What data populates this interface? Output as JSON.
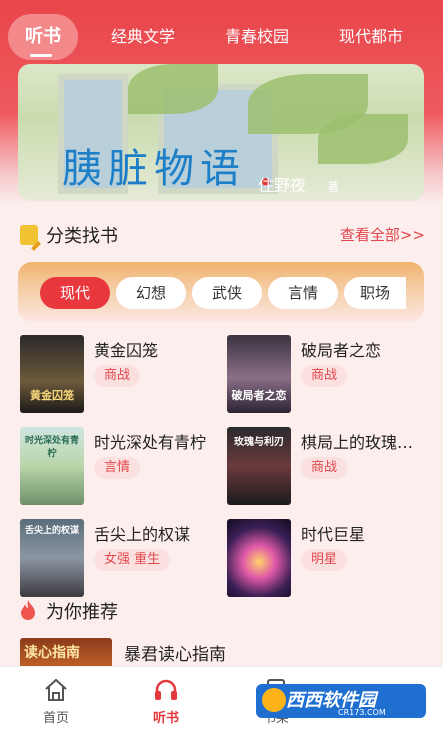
{
  "tabs": [
    {
      "label": "听书",
      "active": true
    },
    {
      "label": "经典文学",
      "active": false
    },
    {
      "label": "青春校园",
      "active": false
    },
    {
      "label": "现代都市",
      "active": false
    }
  ],
  "banner": {
    "title": "胰脏物语",
    "author": "住野夜",
    "author_suffix": "著"
  },
  "category_section": {
    "title": "分类找书",
    "more_label": "查看全部>>"
  },
  "chips": [
    {
      "label": "现代",
      "active": true
    },
    {
      "label": "幻想",
      "active": false
    },
    {
      "label": "武侠",
      "active": false
    },
    {
      "label": "言情",
      "active": false
    },
    {
      "label": "职场",
      "active": false
    }
  ],
  "books": [
    {
      "title": "黄金囚笼",
      "tag": "商战",
      "cover_text": "黄金囚笼"
    },
    {
      "title": "破局者之恋",
      "tag": "商战",
      "cover_text": "破局者之恋"
    },
    {
      "title": "时光深处有青柠",
      "tag": "言情",
      "cover_text": "时光深处有青柠"
    },
    {
      "title": "棋局上的玫瑰…",
      "tag": "商战",
      "cover_text": "玫瑰与利刃"
    },
    {
      "title": "舌尖上的权谋",
      "tag": "女强 重生",
      "cover_text": "舌尖上的权谋"
    },
    {
      "title": "时代巨星",
      "tag": "明星",
      "cover_text": ""
    }
  ],
  "recommend": {
    "title": "为你推荐",
    "items": [
      {
        "title": "暴君读心指南",
        "cover_text": "读心指南"
      }
    ]
  },
  "bottom_nav": [
    {
      "label": "首页",
      "icon": "home-icon",
      "active": false
    },
    {
      "label": "听书",
      "icon": "headphones-icon",
      "active": true
    },
    {
      "label": "书架",
      "icon": "bookshelf-icon",
      "active": false
    }
  ],
  "watermark": {
    "text": "西西软件园",
    "sub": "CR173.COM"
  },
  "colors": {
    "accent": "#e8383e",
    "tag_bg": "#fbe0e0",
    "header_red": "#e8454a"
  }
}
